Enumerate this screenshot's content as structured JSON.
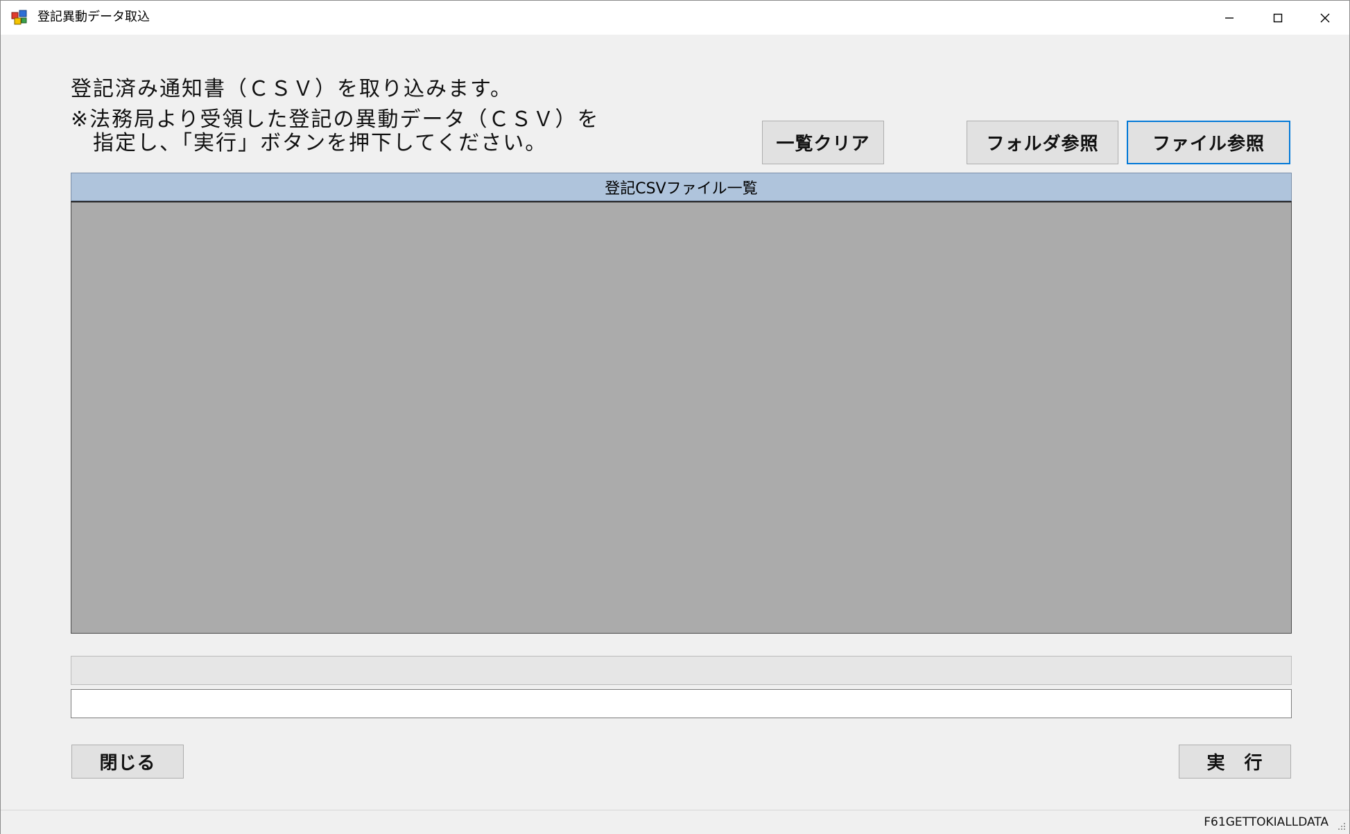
{
  "window": {
    "title": "登記異動データ取込",
    "icon": "app-icon"
  },
  "instructions": {
    "line1": "登記済み通知書（ＣＳＶ）を取り込みます。",
    "line2": "※法務局より受領した登記の異動データ（ＣＳＶ）を",
    "line3": "　指定し、「実行」ボタンを押下してください。"
  },
  "toolbar": {
    "clear_list_label": "一覧クリア",
    "folder_browse_label": "フォルダ参照",
    "file_browse_label": "ファイル参照"
  },
  "file_list": {
    "header": "登記CSVファイル一覧",
    "items": []
  },
  "progress": {
    "value": 0
  },
  "status_message": "",
  "footer": {
    "close_label": "閉じる",
    "execute_label": "実　行"
  },
  "statusbar": {
    "form_id": "F61GETTOKIALLDATA"
  },
  "colors": {
    "list_header_bg": "#afc4dc",
    "list_body_bg": "#ababab",
    "focus_border": "#0078d7",
    "window_bg": "#f0f0f0"
  }
}
